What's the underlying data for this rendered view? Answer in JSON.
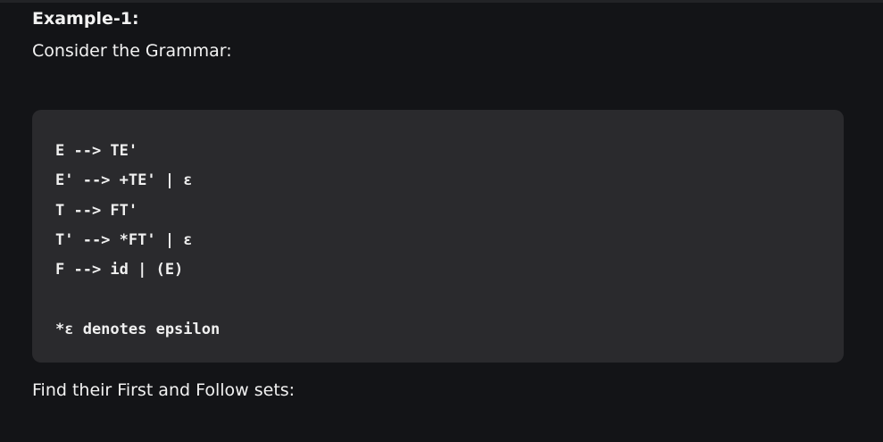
{
  "heading": "Example-1:",
  "intro": "Consider the Grammar:",
  "code_lines": [
    "E --> TE'",
    "E' --> +TE' | ε",
    "T --> FT'",
    "T' --> *FT' | ε",
    "F --> id | (E)",
    "",
    "*ε denotes epsilon"
  ],
  "question": "Find their First and Follow sets:"
}
